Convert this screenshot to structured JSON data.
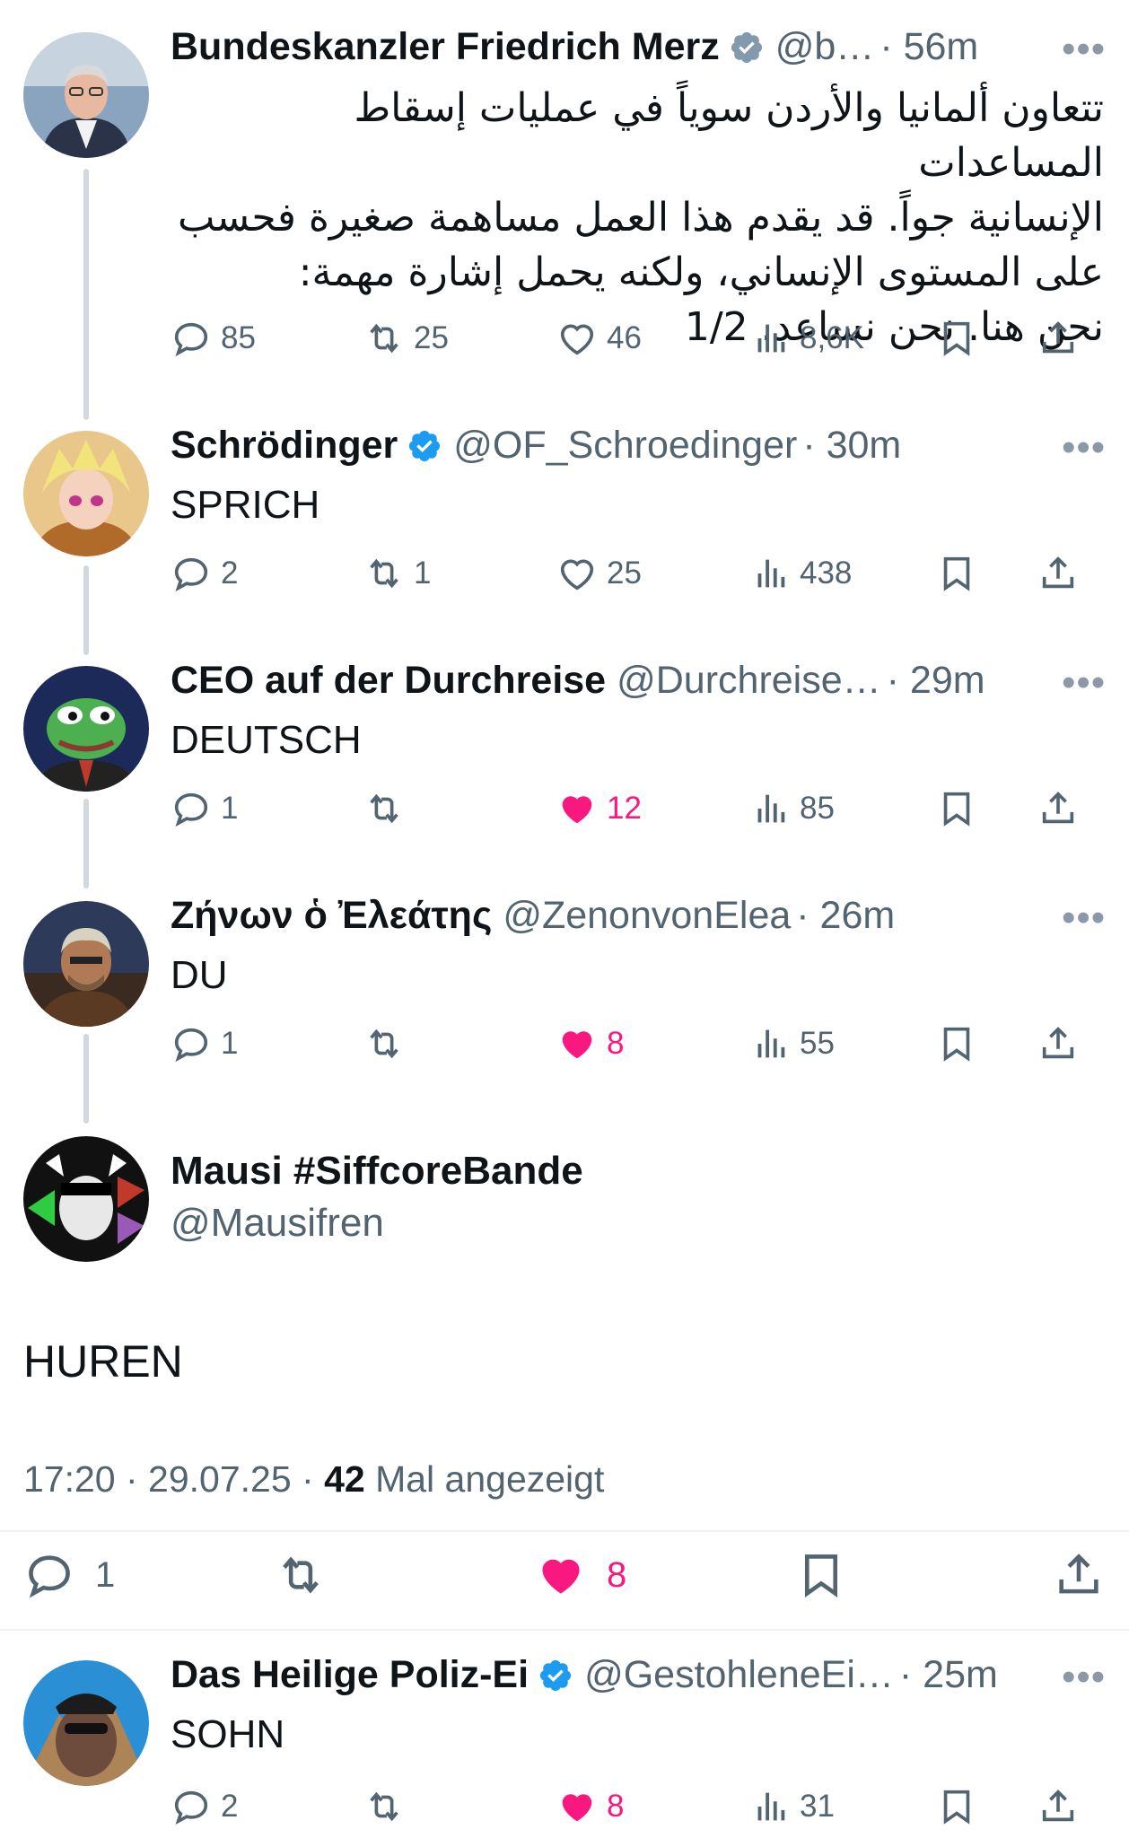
{
  "tweets": [
    {
      "name": "Bundeskanzler Friedrich Merz",
      "handle": "@b…",
      "time": "· 56m",
      "text_lines": [
        "تتعاون ألمانيا والأردن سوياً في عمليات إسقاط المساعدات",
        "الإنسانية جواً. قد يقدم هذا العمل مساهمة صغيرة فحسب",
        "على المستوى الإنساني، ولكنه يحمل إشارة مهمة:",
        "نحن هنا. نحن نساعد. 1/2"
      ],
      "replies": "85",
      "reposts": "25",
      "likes": "46",
      "views": "8,6K",
      "liked": false
    },
    {
      "name": "Schrödinger",
      "handle": "@OF_Schroedinger",
      "time": "· 30m",
      "text": "SPRICH",
      "replies": "2",
      "reposts": "1",
      "likes": "25",
      "views": "438",
      "liked": false
    },
    {
      "name": "CEO auf der Durchreise",
      "handle": "@Durchreise…",
      "time": "· 29m",
      "text": "DEUTSCH",
      "replies": "1",
      "reposts": "",
      "likes": "12",
      "views": "85",
      "liked": true
    },
    {
      "name": "Ζήνων ὁ Ἐλεάτης",
      "handle": "@ZenonvonElea",
      "time": "· 26m",
      "text": "DU",
      "replies": "1",
      "reposts": "",
      "likes": "8",
      "views": "55",
      "liked": true
    }
  ],
  "focus": {
    "name": "Mausi #SiffcoreBande",
    "handle": "@Mausifren",
    "text": "HUREN",
    "time_date": "17:20 · 29.07.25 · ",
    "views_count": "42",
    "views_label": " Mal angezeigt",
    "replies": "1",
    "likes": "8"
  },
  "reply": {
    "name": "Das Heilige Poliz-Ei",
    "handle": "@GestohleneEi…",
    "time": "· 25m",
    "text": "SOHN",
    "replies": "2",
    "reposts": "",
    "likes": "8",
    "views": "31",
    "liked": true
  },
  "more_glyph": "•••",
  "colors": {
    "verified": "#1d9bf0",
    "verified_gray": "#829aab",
    "like": "#f91880",
    "muted": "#536471"
  }
}
